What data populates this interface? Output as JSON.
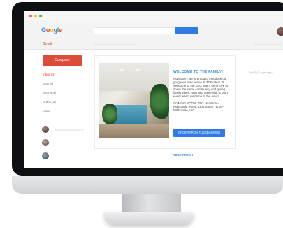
{
  "brand": {
    "logo_letters": [
      "G",
      "o",
      "o",
      "g",
      "l",
      "e"
    ],
    "logo_colors": [
      "#4285F4",
      "#EA4335",
      "#FBBC05",
      "#4285F4",
      "#34A853",
      "#EA4335"
    ]
  },
  "header": {
    "mail_label": "Gmail",
    "search_button_color": "#2f7ae5"
  },
  "sidebar": {
    "compose_label": "Compose",
    "items": [
      {
        "label": "Inbox (1)"
      },
      {
        "label": "Starred"
      },
      {
        "label": "Sent Mail"
      },
      {
        "label": "Drafts (2)"
      },
      {
        "label": "More"
      }
    ]
  },
  "email": {
    "title": "WELCOME TO THE FAMILY!",
    "paragraphs": [
      "Now open, we're proud to introduce our gorgeous new venue at 37 Rotters St. Welcome to the ZEG team! We'd love to share the same community and giving family vibes. Now and come visit is our 5 every warm welcome to the area!",
      "COMING SOON: ZEG Hamilton – Newcastle, NSW; ZEG South Yarra – Melbourne, VIC"
    ],
    "cta_label": "ORDER FROM TUESDAY/NEW",
    "right_meta": "Feb 3 (2 days ago)"
  },
  "email2": {
    "title": "THINK FRESH"
  },
  "colors": {
    "compose": "#dd4b39",
    "accent_blue": "#3a8ed6",
    "monitor_frame": "#0e0f12"
  }
}
